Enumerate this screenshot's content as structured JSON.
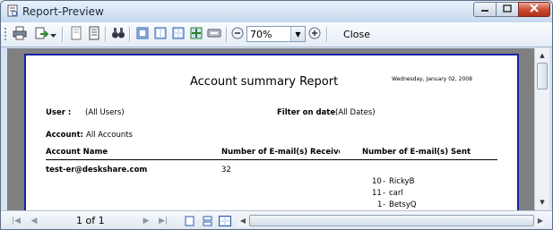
{
  "window": {
    "title": "Report-Preview"
  },
  "toolbar": {
    "icons": [
      "print-icon",
      "export-icon",
      "page-setup-icon",
      "page-icon",
      "find-icon",
      "single-page-icon",
      "two-page-icon",
      "four-page-icon",
      "multi-page-icon",
      "toggle-view-icon",
      "zoom-out-icon",
      "zoom-in-icon"
    ],
    "zoom_value": "70%",
    "close_label": "Close"
  },
  "report": {
    "title": "Account summary Report",
    "date": "Wednesday, January 02, 2008",
    "user_label": "User :",
    "user_value": "(All Users)",
    "filter_label": "Filter on date",
    "filter_value": "(All Dates)",
    "account_label": "Account:",
    "account_value": "All Accounts",
    "columns": [
      "Account Name",
      "Number of E-mail(s) Receivec",
      "Number of E-mail(s) Sent"
    ],
    "rows": [
      {
        "account": "test-er@deskshare.com",
        "received": "32",
        "sent": [
          {
            "count": "10",
            "name": "RickyB"
          },
          {
            "count": "11",
            "name": "carl"
          },
          {
            "count": "1",
            "name": "BetsyQ"
          }
        ]
      }
    ]
  },
  "statusbar": {
    "page_indicator": "1 of 1"
  }
}
